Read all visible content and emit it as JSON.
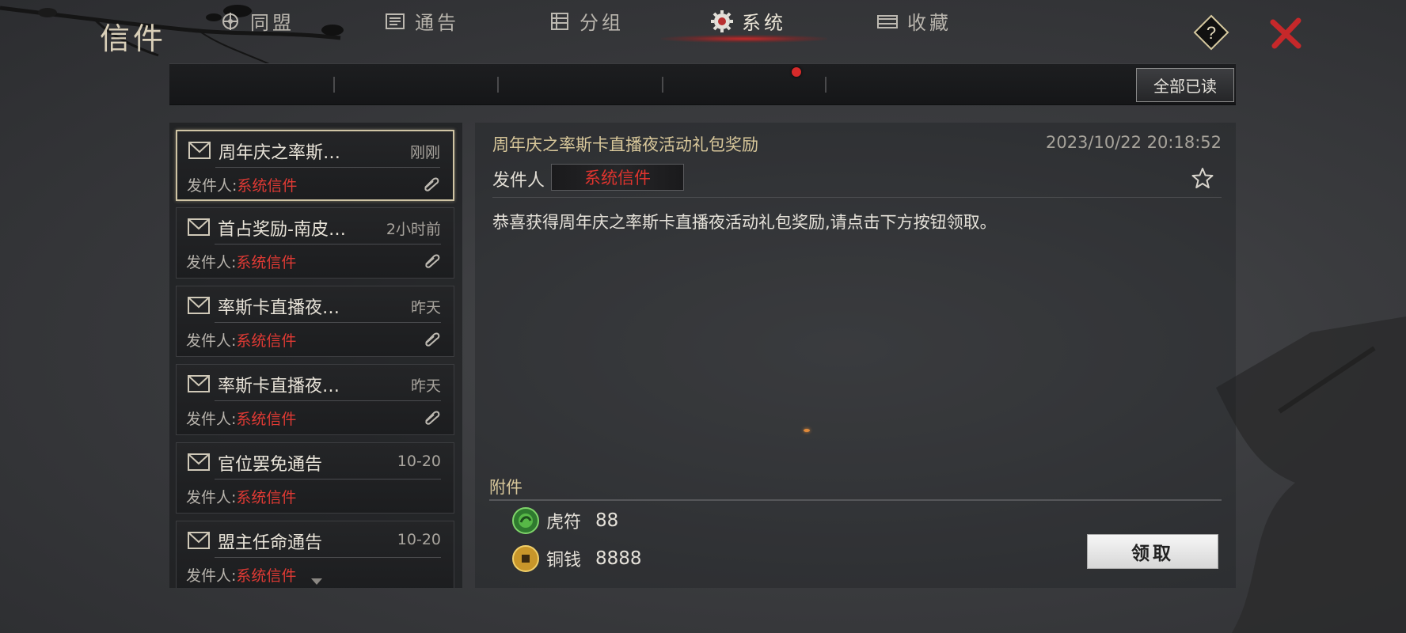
{
  "window": {
    "title": "信件"
  },
  "tabs": [
    {
      "label": "同盟",
      "icon": "alliance-icon"
    },
    {
      "label": "通告",
      "icon": "notice-icon"
    },
    {
      "label": "分组",
      "icon": "group-icon"
    },
    {
      "label": "系统",
      "icon": "system-gear-icon",
      "active": true,
      "has_new": true
    },
    {
      "label": "收藏",
      "icon": "favorites-icon"
    }
  ],
  "toolbar": {
    "read_all_label": "全部已读"
  },
  "mail_list": [
    {
      "subject": "周年庆之率斯…",
      "time": "刚刚",
      "sender_label": "发件人:",
      "sender": "系统信件",
      "has_attachment": true,
      "selected": true
    },
    {
      "subject": "首占奖励-南皮…",
      "time": "2小时前",
      "sender_label": "发件人:",
      "sender": "系统信件",
      "has_attachment": true
    },
    {
      "subject": "率斯卡直播夜…",
      "time": "昨天",
      "sender_label": "发件人:",
      "sender": "系统信件",
      "has_attachment": true
    },
    {
      "subject": "率斯卡直播夜…",
      "time": "昨天",
      "sender_label": "发件人:",
      "sender": "系统信件",
      "has_attachment": true
    },
    {
      "subject": "官位罢免通告",
      "time": "10-20",
      "sender_label": "发件人:",
      "sender": "系统信件",
      "has_attachment": false
    },
    {
      "subject": "盟主任命通告",
      "time": "10-20",
      "sender_label": "发件人:",
      "sender": "系统信件",
      "has_attachment": false
    }
  ],
  "detail": {
    "subject": "周年庆之率斯卡直播夜活动礼包奖励",
    "date": "2023/10/22 20:18:52",
    "sender_label": "发件人",
    "sender": "系统信件",
    "body": "恭喜获得周年庆之率斯卡直播夜活动礼包奖励,请点击下方按钮领取。",
    "attachments_title": "附件",
    "attachments": [
      {
        "name": "虎符",
        "qty": "88",
        "icon": "tiger-tally-icon"
      },
      {
        "name": "铜钱",
        "qty": "8888",
        "icon": "copper-coin-icon"
      }
    ],
    "claim_label": "领取"
  },
  "colors": {
    "accent_red": "#e0342e",
    "gold_text": "#d8c79a",
    "selected_border": "#cfc4a4"
  }
}
